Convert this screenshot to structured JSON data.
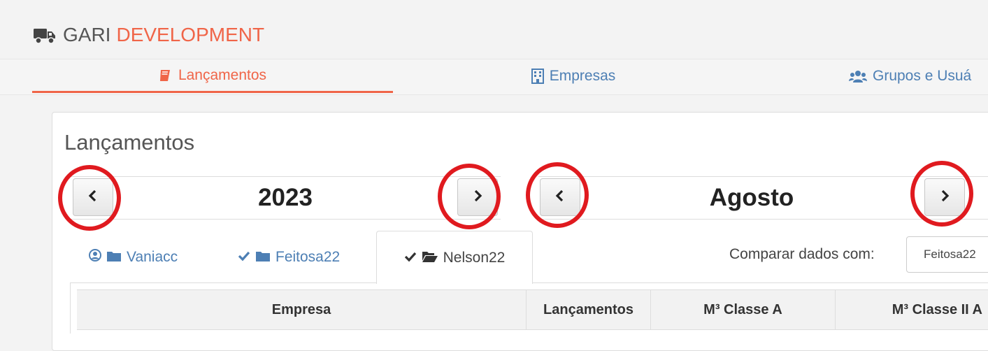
{
  "brand": {
    "word1": "GARI",
    "word2": "DEVELOPMENT",
    "icon": "truck-icon",
    "accent": "#f06548"
  },
  "nav": {
    "tabs": [
      {
        "label": "Lançamentos",
        "icon": "book-icon",
        "active": true
      },
      {
        "label": "Empresas",
        "icon": "building-icon",
        "active": false
      },
      {
        "label": "Grupos e Usuá",
        "icon": "users-icon",
        "active": false
      }
    ]
  },
  "panel": {
    "title": "Lançamentos"
  },
  "year_stepper": {
    "value": "2023",
    "prev_icon": "chevron-left-icon",
    "next_icon": "chevron-right-icon"
  },
  "month_stepper": {
    "value": "Agosto",
    "prev_icon": "chevron-left-icon",
    "next_icon": "chevron-right-icon"
  },
  "highlight_color": "#e01a1f",
  "subtabs": [
    {
      "label": "Vaniacc",
      "icons": [
        "user-circle-icon",
        "folder-icon"
      ],
      "active": false
    },
    {
      "label": "Feitosa22",
      "icons": [
        "check-icon",
        "folder-icon"
      ],
      "active": false
    },
    {
      "label": "Nelson22",
      "icons": [
        "check-icon",
        "folder-open-icon"
      ],
      "active": true
    }
  ],
  "compare": {
    "label": "Comparar dados com:",
    "selected": "Feitosa22"
  },
  "table": {
    "headers": [
      "Empresa",
      "Lançamentos",
      "M³ Classe A",
      "M³ Classe II A"
    ]
  }
}
